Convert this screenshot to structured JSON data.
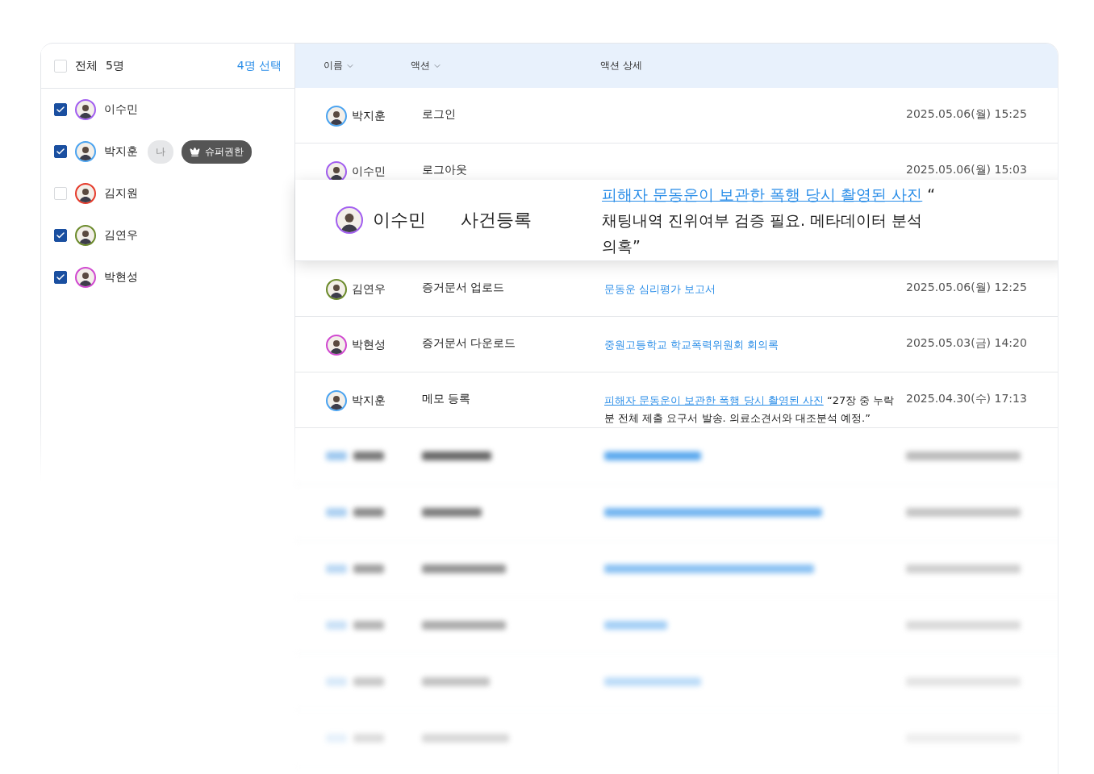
{
  "sidebar": {
    "select_all": {
      "label": "전체",
      "count": "5명",
      "checked": false
    },
    "selected_count": "4명 선택",
    "members": [
      {
        "name": "이수민",
        "checked": true,
        "color": "#a25ef0"
      },
      {
        "name": "박지훈",
        "checked": true,
        "color": "#4aa3f0",
        "badges": [
          {
            "kind": "me",
            "label": "나"
          },
          {
            "kind": "role",
            "label": "슈퍼권한"
          }
        ]
      },
      {
        "name": "김지원",
        "checked": false,
        "color": "#e53a2a"
      },
      {
        "name": "김연우",
        "checked": true,
        "color": "#6b8a2a"
      },
      {
        "name": "박현성",
        "checked": true,
        "color": "#d048d0"
      }
    ]
  },
  "table": {
    "columns": [
      {
        "label": "이름",
        "sortable": true
      },
      {
        "label": "액션",
        "sortable": true
      },
      {
        "label": "액션 상세",
        "sortable": false
      }
    ],
    "rows": [
      {
        "kind": "entry",
        "name": "박지훈",
        "color": "#4aa3f0",
        "action": "로그인",
        "time": "2025.05.06(월) 15:25"
      },
      {
        "kind": "entry",
        "name": "이수민",
        "color": "#a25ef0",
        "action": "로그아웃",
        "time": "2025.05.06(월) 15:03"
      },
      {
        "kind": "highlighted",
        "name": "이수민",
        "color": "#a25ef0",
        "action": "사건등록",
        "detail_link": "피해자 문동운이 보관한 폭행 당시 촬영된 사진",
        "detail_note": " “ 채팅내역 진위여부 검증 필요. 메타데이터 분석 의혹”"
      },
      {
        "kind": "entry",
        "name": "김연우",
        "color": "#6b8a2a",
        "action": "증거문서 업로드",
        "detail_link": "문동운 심리평가 보고서",
        "time": "2025.05.06(월) 12:25"
      },
      {
        "kind": "entry",
        "name": "박현성",
        "color": "#d048d0",
        "action": "증거문서 다운로드",
        "detail_link": "중원고등학교 학교폭력위원회 회의록",
        "time": "2025.05.03(금) 14:20"
      },
      {
        "kind": "entry",
        "name": "박지훈",
        "color": "#4aa3f0",
        "action": "메모 등록",
        "detail_link": "피해자 문동운이 보관한 폭행 당시 촬영된 사진",
        "detail_note": " “27장 중 누락분 전체 제출 요구서 발송. 의료소견서와 대조분석 예정.”",
        "time": "2025.04.30(수) 17:13"
      }
    ],
    "blurred_rows": [
      {
        "detail": true
      },
      {
        "detail": true
      },
      {
        "detail": true
      },
      {
        "detail": true
      },
      {
        "detail": true
      },
      {
        "detail": false
      }
    ]
  }
}
